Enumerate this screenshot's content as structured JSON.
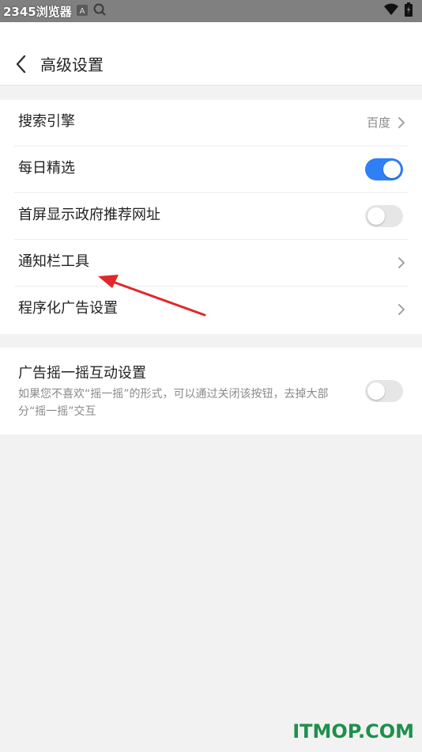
{
  "status_bar": {
    "app_title": "2345浏览器",
    "icons": [
      "android-icon",
      "a-icon",
      "search-icon",
      "wifi-icon",
      "battery-icon"
    ]
  },
  "header": {
    "back_icon": "chevron-left-icon",
    "title": "高级设置"
  },
  "settings": {
    "search_engine": {
      "label": "搜索引擎",
      "value": "百度"
    },
    "daily_picks": {
      "label": "每日精选",
      "enabled": true
    },
    "gov_sites": {
      "label": "首屏显示政府推荐网址",
      "enabled": false
    },
    "notification_tools": {
      "label": "通知栏工具"
    },
    "programmatic_ads": {
      "label": "程序化广告设置"
    }
  },
  "shake_ads": {
    "label": "广告摇一摇互动设置",
    "description": "如果您不喜欢“摇一摇”的形式，可以通过关闭该按钮，去掉大部分“摇一摇”交互",
    "enabled": false
  },
  "colors": {
    "accent": "#2f7ff5",
    "annotation_arrow": "#e0282a",
    "watermark": "#1e8f4d"
  },
  "watermark": "ITMOP.COM"
}
